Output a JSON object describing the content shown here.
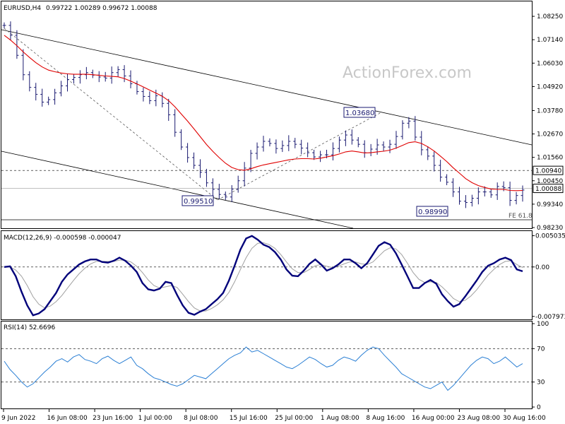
{
  "watermark": "ActionForex.com",
  "colors": {
    "candle": "#1a1a70",
    "sma": "#e00000",
    "macd": "#00007a",
    "signal": "#a0a0a0",
    "rsi": "#2a7fd4",
    "channel": "#000000",
    "grid": "#c0c0c0",
    "callout_border": "#1a1a70"
  },
  "chart_data": [
    {
      "type": "candlestick",
      "title": "EURUSD,H4",
      "ohlc_header": "0.99722 1.00289 0.99672 1.00088",
      "ylim": [
        0.9823,
        1.0889
      ],
      "y_ticks": [
        "1.08250",
        "1.07140",
        "1.06030",
        "1.04920",
        "1.03780",
        "1.02670",
        "1.01560",
        "1.00450",
        "0.99340",
        "0.98230"
      ],
      "y_tick_values": [
        1.0825,
        1.0714,
        1.0603,
        1.0492,
        1.0378,
        1.0267,
        1.0156,
        1.0045,
        0.9934,
        0.9823
      ],
      "level_labels": [
        {
          "text": "1.00940",
          "value": 1.0094
        },
        {
          "text": "1.00088",
          "value": 1.00088
        }
      ],
      "x_ticks": [
        "9 Jun 2022",
        "16 Jun 08:00",
        "23 Jun 16:00",
        "1 Jul 00:00",
        "8 Jul 08:00",
        "15 Jul 16:00",
        "25 Jul 00:00",
        "1 Aug 08:00",
        "8 Aug 16:00",
        "16 Aug 00:00",
        "23 Aug 08:00",
        "30 Aug 16:00"
      ],
      "series": [
        {
          "name": "close",
          "values": [
            1.0782,
            1.0735,
            1.064,
            1.0548,
            1.0488,
            1.0455,
            1.0418,
            1.043,
            1.0462,
            1.0495,
            1.0525,
            1.0535,
            1.0548,
            1.0558,
            1.0546,
            1.0537,
            1.0532,
            1.0558,
            1.0572,
            1.0542,
            1.0505,
            1.0468,
            1.0445,
            1.0425,
            1.0448,
            1.0412,
            1.0358,
            1.0275,
            1.0205,
            1.0155,
            1.0118,
            1.0085,
            1.0035,
            1.0004,
            0.998,
            0.9968,
            1.0005,
            1.0045,
            1.0105,
            1.0175,
            1.0205,
            1.0232,
            1.0222,
            1.0198,
            1.0212,
            1.0232,
            1.0218,
            1.02,
            1.0178,
            1.0158,
            1.0168,
            1.0168,
            1.0198,
            1.0238,
            1.0262,
            1.0238,
            1.0218,
            1.0178,
            1.0195,
            1.0215,
            1.0205,
            1.0218,
            1.0255,
            1.0318,
            1.0328,
            1.0252,
            1.0192,
            1.0162,
            1.0118,
            1.0062,
            1.0038,
            0.9992,
            0.9948,
            0.9942,
            0.9962,
            0.9992,
            0.9992,
            0.9978,
            1.0018,
            1.0012,
            0.9952,
            0.9975,
            1.0001
          ]
        },
        {
          "name": "SMA",
          "values": [
            1.0735,
            1.0712,
            1.0686,
            1.0656,
            1.063,
            1.0605,
            1.0585,
            1.057,
            1.0562,
            1.0556,
            1.0552,
            1.055,
            1.055,
            1.055,
            1.0548,
            1.0545,
            1.0542,
            1.054,
            1.0538,
            1.053,
            1.0518,
            1.0504,
            1.049,
            1.0475,
            1.0461,
            1.0446,
            1.0425,
            1.0396,
            1.0362,
            1.0328,
            1.0292,
            1.0254,
            1.0217,
            1.0184,
            1.0155,
            1.0128,
            1.0108,
            1.0098,
            1.0095,
            1.0102,
            1.0112,
            1.012,
            1.0126,
            1.0132,
            1.0138,
            1.0144,
            1.0148,
            1.015,
            1.015,
            1.0148,
            1.0152,
            1.0158,
            1.0164,
            1.0172,
            1.0182,
            1.0186,
            1.0182,
            1.0177,
            1.0178,
            1.0182,
            1.0185,
            1.019,
            1.02,
            1.0213,
            1.0226,
            1.023,
            1.0222,
            1.0206,
            1.0186,
            1.0162,
            1.0136,
            1.0107,
            1.0081,
            1.0055,
            1.0036,
            1.0022,
            1.0013,
            1.0006,
            1.0004,
            1.0004,
            0.9999,
            0.9998,
            0.9999
          ]
        }
      ],
      "annotations": [
        {
          "text": "1.03680",
          "value": 1.0368
        },
        {
          "text": "0.99510",
          "value": 0.9951
        },
        {
          "text": "0.98990",
          "value": 0.9899
        },
        {
          "text": "FE 61.8"
        }
      ]
    },
    {
      "type": "line",
      "title": "MACD(12,26,9) -0.000598 -0.000047",
      "ylim": [
        -0.008,
        0.0051
      ],
      "y_ticks": [
        "0.005035",
        "0.00",
        "-0.007973"
      ],
      "y_tick_values": [
        0.005035,
        0.0,
        -0.007973
      ],
      "series": [
        {
          "name": "MACD",
          "values": [
            0.0,
            0.0001,
            -0.0015,
            -0.004,
            -0.0062,
            -0.0078,
            -0.0075,
            -0.0068,
            -0.0055,
            -0.0042,
            -0.0024,
            -0.0012,
            -0.0004,
            0.0004,
            0.0009,
            0.0012,
            0.0012,
            0.0008,
            0.0007,
            0.001,
            0.0015,
            0.001,
            0.0002,
            -0.0008,
            -0.0026,
            -0.0036,
            -0.0038,
            -0.0035,
            -0.0024,
            -0.0026,
            -0.0045,
            -0.0062,
            -0.0074,
            -0.0077,
            -0.0072,
            -0.0068,
            -0.006,
            -0.0052,
            -0.0042,
            -0.0022,
            0.0002,
            0.0028,
            0.0046,
            0.005,
            0.0044,
            0.0036,
            0.0032,
            0.0024,
            0.0012,
            -0.0004,
            -0.0014,
            -0.0015,
            -0.0006,
            0.0005,
            0.0012,
            0.0004,
            -0.0006,
            -0.0002,
            0.0004,
            0.0012,
            0.0012,
            0.0006,
            -0.0002,
            0.0006,
            0.002,
            0.0034,
            0.004,
            0.0036,
            0.0022,
            0.0004,
            -0.0015,
            -0.0034,
            -0.0034,
            -0.0026,
            -0.0021,
            -0.0027,
            -0.0044,
            -0.0055,
            -0.0064,
            -0.006,
            -0.0048,
            -0.0035,
            -0.0022,
            -0.0008,
            0.0002,
            0.0006,
            0.0012,
            0.0015,
            0.0011,
            -0.0004,
            -0.0007
          ]
        },
        {
          "name": "Signal",
          "values": [
            0.0,
            0.0,
            -0.0005,
            -0.0015,
            -0.003,
            -0.0048,
            -0.006,
            -0.0066,
            -0.0063,
            -0.0056,
            -0.0046,
            -0.0034,
            -0.0022,
            -0.0011,
            -0.0002,
            0.0005,
            0.0009,
            0.0009,
            0.0009,
            0.0009,
            0.0011,
            0.0011,
            0.0008,
            0.0001,
            -0.0009,
            -0.0021,
            -0.003,
            -0.0034,
            -0.0032,
            -0.003,
            -0.0033,
            -0.0044,
            -0.0056,
            -0.0066,
            -0.0071,
            -0.0071,
            -0.0067,
            -0.0061,
            -0.0053,
            -0.0041,
            -0.0024,
            -0.0004,
            0.0015,
            0.003,
            0.0038,
            0.0039,
            0.0036,
            0.003,
            0.002,
            0.0008,
            -0.0003,
            -0.0009,
            -0.0009,
            -0.0004,
            0.0002,
            0.0004,
            0.0001,
            -0.0001,
            0.0001,
            0.0005,
            0.0008,
            0.0008,
            0.0005,
            0.0004,
            0.0008,
            0.0017,
            0.0026,
            0.0031,
            0.0029,
            0.002,
            0.0006,
            -0.0009,
            -0.002,
            -0.0025,
            -0.0024,
            -0.0025,
            -0.0032,
            -0.0041,
            -0.0051,
            -0.0056,
            -0.0054,
            -0.0047,
            -0.0037,
            -0.0025,
            -0.0013,
            -0.0004,
            0.0004,
            0.0009,
            0.001,
            0.0004,
            -0.0001
          ]
        }
      ]
    },
    {
      "type": "line",
      "title": "RSI(14) 52.6696",
      "ylim": [
        0,
        100
      ],
      "y_ticks": [
        "100",
        "70",
        "30",
        "0"
      ],
      "y_tick_values": [
        100,
        70,
        30,
        0
      ],
      "series": [
        {
          "name": "RSI",
          "values": [
            55,
            45,
            38,
            30,
            24,
            28,
            35,
            42,
            48,
            55,
            58,
            54,
            60,
            63,
            57,
            55,
            52,
            58,
            61,
            56,
            52,
            56,
            60,
            50,
            46,
            40,
            35,
            33,
            30,
            27,
            25,
            28,
            33,
            38,
            36,
            34,
            40,
            46,
            52,
            58,
            62,
            65,
            72,
            66,
            68,
            64,
            60,
            56,
            52,
            48,
            46,
            50,
            55,
            60,
            57,
            52,
            48,
            50,
            56,
            60,
            58,
            55,
            62,
            68,
            72,
            70,
            62,
            55,
            48,
            40,
            36,
            32,
            28,
            24,
            22,
            26,
            30,
            20,
            26,
            34,
            42,
            50,
            56,
            60,
            58,
            52,
            55,
            60,
            54,
            48,
            52
          ]
        }
      ]
    }
  ]
}
